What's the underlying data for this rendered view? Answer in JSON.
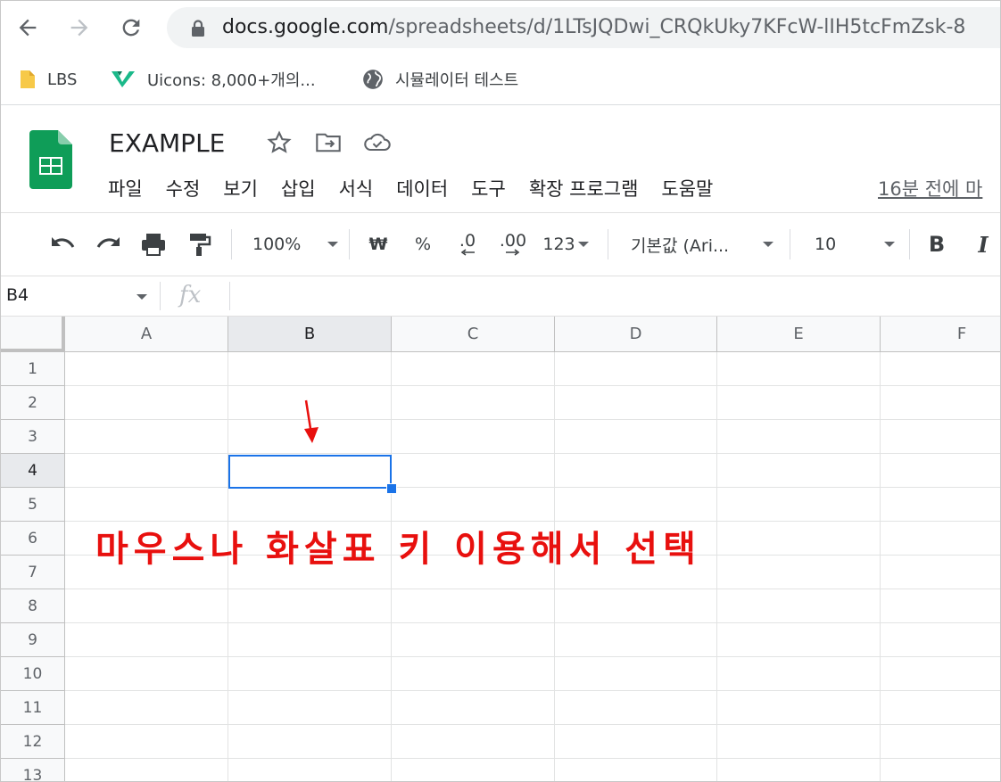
{
  "browser": {
    "url_host": "docs.google.com",
    "url_path": "/spreadsheets/d/1LTsJQDwi_CRQkUky7KFcW-lIH5tcFmZsk-8"
  },
  "bookmarks": [
    {
      "label": "LBS",
      "icon": "folder-icon"
    },
    {
      "label": "Uicons: 8,000+개의...",
      "icon": "uicons-icon"
    },
    {
      "label": "시뮬레이터 테스트",
      "icon": "globe-icon"
    }
  ],
  "document": {
    "title": "EXAMPLE",
    "last_edit": "16분 전에 마"
  },
  "menu": [
    "파일",
    "수정",
    "보기",
    "삽입",
    "서식",
    "데이터",
    "도구",
    "확장 프로그램",
    "도움말"
  ],
  "toolbar": {
    "zoom": "100%",
    "currency": "₩",
    "percent": "%",
    "decimal_decrease": ".0",
    "decimal_increase": ".00",
    "format": "123",
    "font": "기본값 (Ari...",
    "font_size": "10",
    "bold": "B",
    "italic": "I"
  },
  "formula_bar": {
    "name_box": "B4",
    "fx": "fx"
  },
  "grid": {
    "columns": [
      "A",
      "B",
      "C",
      "D",
      "E",
      "F"
    ],
    "rows": [
      "1",
      "2",
      "3",
      "4",
      "5",
      "6",
      "7",
      "8",
      "9",
      "10",
      "11",
      "12",
      "13"
    ],
    "selected_column": "B",
    "selected_row": "4"
  },
  "annotation": "마우스나 화살표 키 이용해서 선택",
  "colors": {
    "accent": "#1a73e8",
    "annotation": "#e8100e",
    "sheets_green": "#0f9d58"
  }
}
